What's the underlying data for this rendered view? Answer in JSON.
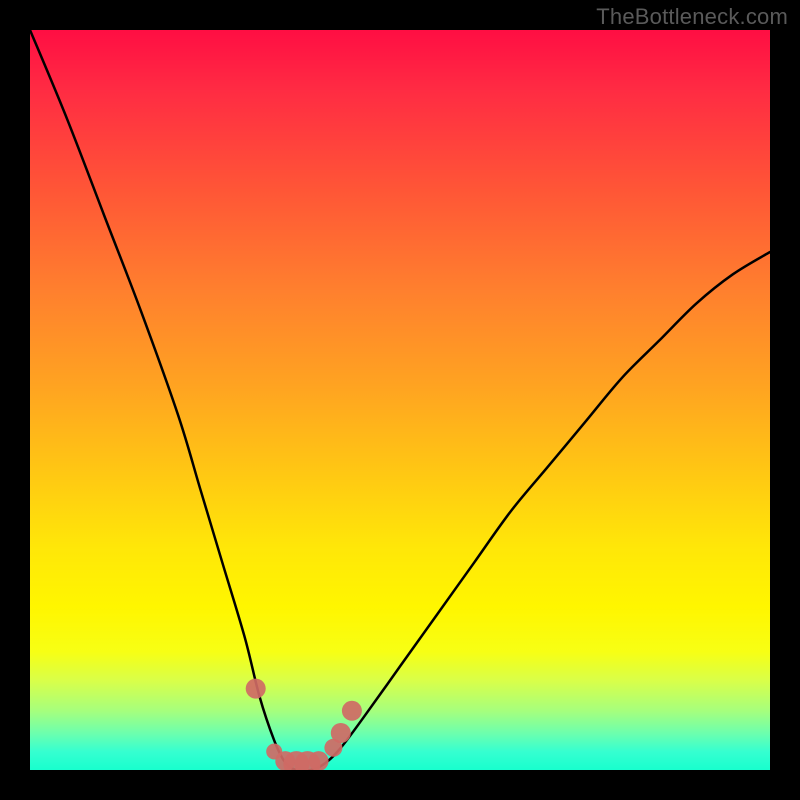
{
  "watermark": "TheBottleneck.com",
  "chart_data": {
    "type": "line",
    "title": "",
    "xlabel": "",
    "ylabel": "",
    "xlim": [
      0,
      100
    ],
    "ylim": [
      0,
      100
    ],
    "series": [
      {
        "name": "bottleneck-curve",
        "x": [
          0,
          5,
          10,
          15,
          20,
          23,
          26,
          29,
          31,
          33,
          34.5,
          36,
          38,
          40,
          42,
          45,
          50,
          55,
          60,
          65,
          70,
          75,
          80,
          85,
          90,
          95,
          100
        ],
        "values": [
          100,
          88,
          75,
          62,
          48,
          38,
          28,
          18,
          10,
          4,
          1,
          0,
          0,
          1,
          3,
          7,
          14,
          21,
          28,
          35,
          41,
          47,
          53,
          58,
          63,
          67,
          70
        ]
      }
    ],
    "markers": {
      "name": "highlight-dots",
      "x": [
        30.5,
        33,
        34.5,
        36,
        37.5,
        39,
        41,
        42,
        43.5
      ],
      "values": [
        11,
        2.5,
        1.2,
        0.8,
        0.8,
        1.2,
        3,
        5,
        8
      ],
      "size": [
        10,
        8,
        10,
        13,
        13,
        10,
        9,
        10,
        10
      ]
    },
    "gradient_stops": [
      {
        "pos": 0,
        "color": "#ff0e43"
      },
      {
        "pos": 0.22,
        "color": "#ff5736"
      },
      {
        "pos": 0.48,
        "color": "#ffa321"
      },
      {
        "pos": 0.7,
        "color": "#ffe708"
      },
      {
        "pos": 0.88,
        "color": "#d8ff4a"
      },
      {
        "pos": 1.0,
        "color": "#18ffce"
      }
    ]
  }
}
